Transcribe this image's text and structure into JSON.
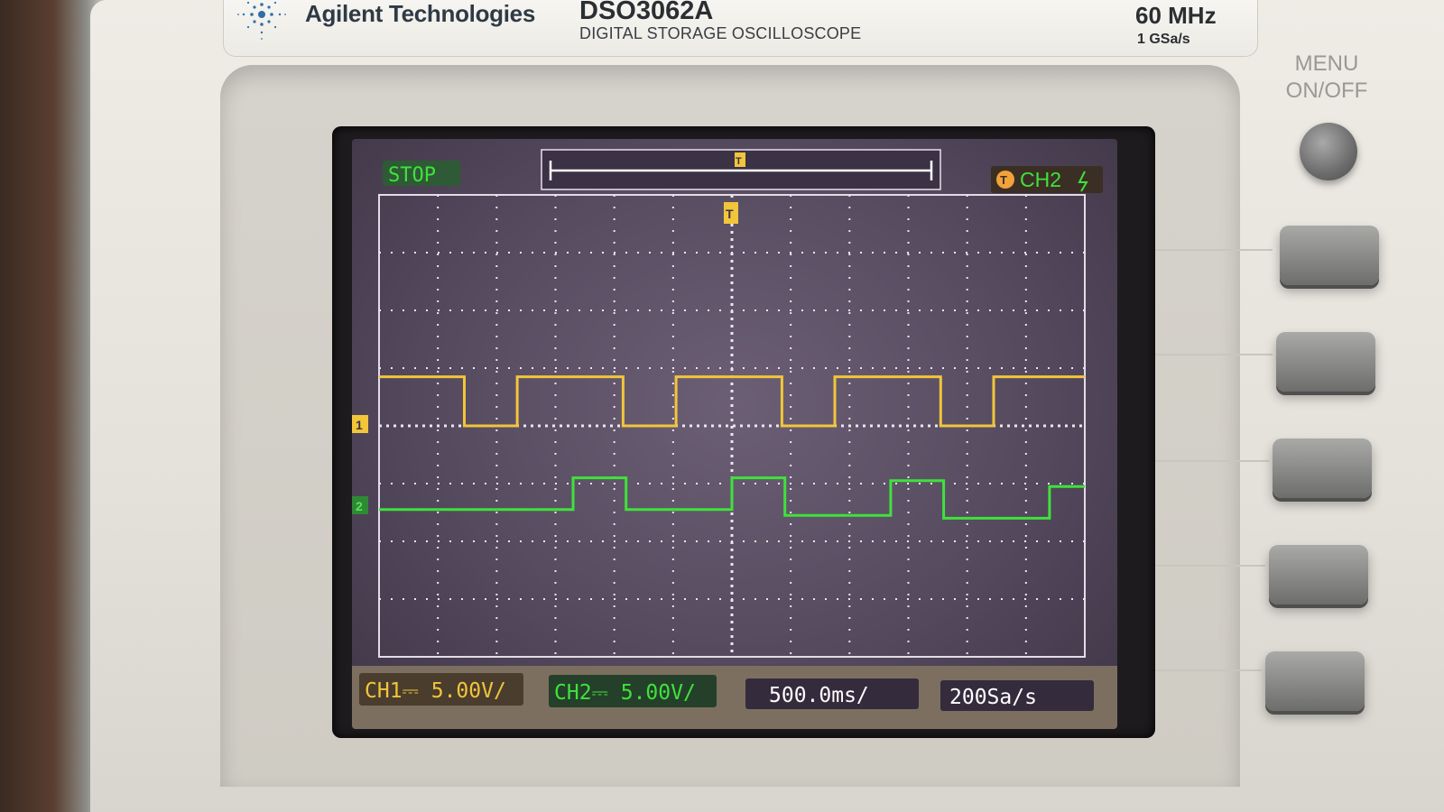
{
  "header": {
    "brand": "Agilent Technologies",
    "model": "DSO3062A",
    "description": "DIGITAL STORAGE OSCILLOSCOPE",
    "bandwidth": "60 MHz",
    "sample_rate_spec": "1 GSa/s"
  },
  "panel": {
    "menu_label_line1": "MENU",
    "menu_label_line2": "ON/OFF"
  },
  "screen": {
    "run_state": "STOP",
    "trigger_marker": "T",
    "trigger_source": "CH2",
    "ch1_marker": "1",
    "ch2_marker": "2",
    "ch1_scale": "CH1⎓ 5.00V/",
    "ch2_scale": "CH2⎓ 5.00V/",
    "timebase": "500.0ms/",
    "sample_rate": "200Sa/s",
    "colors": {
      "ch1": "#f2c53a",
      "ch2": "#3fe23a",
      "status_bg_ch1": "#4a3d2d",
      "status_bg_ch2": "#24402a",
      "stop_bg": "#2f5a36"
    }
  },
  "chart_data": {
    "type": "line",
    "title": "",
    "xlabel": "",
    "ylabel": "",
    "x_units": "divisions",
    "y_units": "divisions",
    "xlim": [
      0,
      12
    ],
    "ylim": [
      -4,
      4
    ],
    "grid": true,
    "series": [
      {
        "name": "1",
        "color": "#f2c53a",
        "x": [
          0,
          1.45,
          1.45,
          2.35,
          2.35,
          4.15,
          4.15,
          5.05,
          5.05,
          6.85,
          6.85,
          7.75,
          7.75,
          9.55,
          9.55,
          10.45,
          10.45,
          12
        ],
        "y": [
          0.85,
          0.85,
          0.0,
          0.0,
          0.85,
          0.85,
          0.0,
          0.0,
          0.85,
          0.85,
          0.0,
          0.0,
          0.85,
          0.85,
          0.0,
          0.0,
          0.85,
          0.85
        ]
      },
      {
        "name": "2",
        "color": "#3fe23a",
        "x": [
          0,
          3.3,
          3.3,
          4.2,
          4.2,
          6.0,
          6.0,
          6.9,
          6.9,
          8.7,
          8.7,
          9.6,
          9.6,
          11.4,
          11.4,
          12
        ],
        "y": [
          -1.45,
          -1.45,
          -0.9,
          -0.9,
          -1.45,
          -1.45,
          -0.9,
          -0.9,
          -1.55,
          -1.55,
          -0.95,
          -0.95,
          -1.6,
          -1.6,
          -1.05,
          -1.05
        ]
      }
    ]
  }
}
